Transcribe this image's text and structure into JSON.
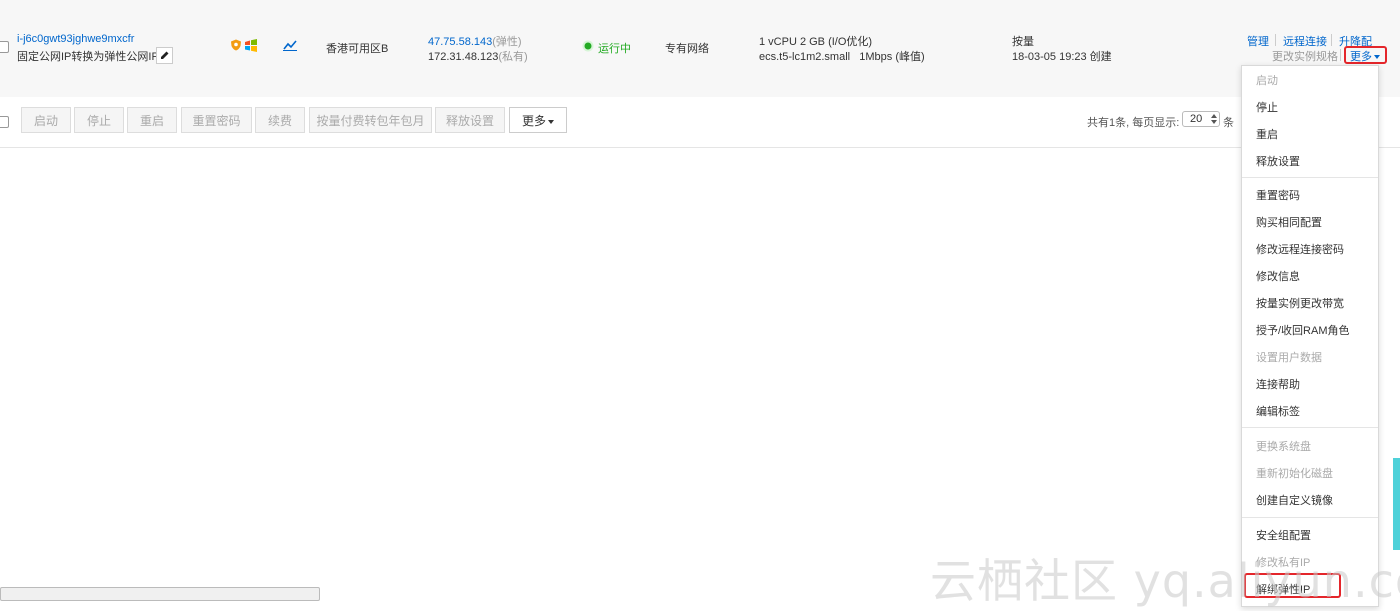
{
  "instance": {
    "id": "i-j6c0gwt93jghwe9mxcfr",
    "name": "固定公网IP转换为弹性公网IP",
    "zone": "香港可用区B",
    "public_ip": "47.75.58.143",
    "public_ip_tag": "(弹性)",
    "private_ip": "172.31.48.123",
    "private_ip_tag": "(私有)",
    "status": "运行中",
    "network": "专有网络",
    "spec_line1": "1 vCPU 2 GB (I/O优化)",
    "spec_line2": "ecs.t5-lc1m2.small   1Mbps (峰值)",
    "billing": "按量",
    "created": "18-03-05 19:23 创建",
    "status_color": "#22aa22"
  },
  "row_actions": {
    "manage": "管理",
    "remote": "远程连接",
    "upgrade": "升降配",
    "change_spec": "更改实例规格",
    "more": "更多"
  },
  "toolbar": {
    "buttons": [
      "启动",
      "停止",
      "重启",
      "重置密码",
      "续费",
      "按量付费转包年包月",
      "释放设置"
    ],
    "more": "更多",
    "pager_prefix": "共有1条, 每页显示:",
    "page_size": "20",
    "pager_suffix": "条"
  },
  "menu": {
    "items": [
      {
        "label": "启动",
        "disabled": true
      },
      {
        "label": "停止",
        "disabled": false
      },
      {
        "label": "重启",
        "disabled": false
      },
      {
        "label": "释放设置",
        "disabled": false
      },
      {
        "label": "重置密码",
        "disabled": false
      },
      {
        "label": "购买相同配置",
        "disabled": false
      },
      {
        "label": "修改远程连接密码",
        "disabled": false
      },
      {
        "label": "修改信息",
        "disabled": false
      },
      {
        "label": "按量实例更改带宽",
        "disabled": false
      },
      {
        "label": "授予/收回RAM角色",
        "disabled": false
      },
      {
        "label": "设置用户数据",
        "disabled": true
      },
      {
        "label": "连接帮助",
        "disabled": false
      },
      {
        "label": "编辑标签",
        "disabled": false
      },
      {
        "label": "更换系统盘",
        "disabled": true
      },
      {
        "label": "重新初始化磁盘",
        "disabled": true
      },
      {
        "label": "创建自定义镜像",
        "disabled": false
      },
      {
        "label": "安全组配置",
        "disabled": false
      },
      {
        "label": "修改私有IP",
        "disabled": true
      },
      {
        "label": "解绑弹性IP",
        "disabled": false
      }
    ]
  },
  "watermark": "云栖社区 yq.aliyun.com",
  "highlight_color": "#e4262b",
  "link_color": "#0066cc"
}
